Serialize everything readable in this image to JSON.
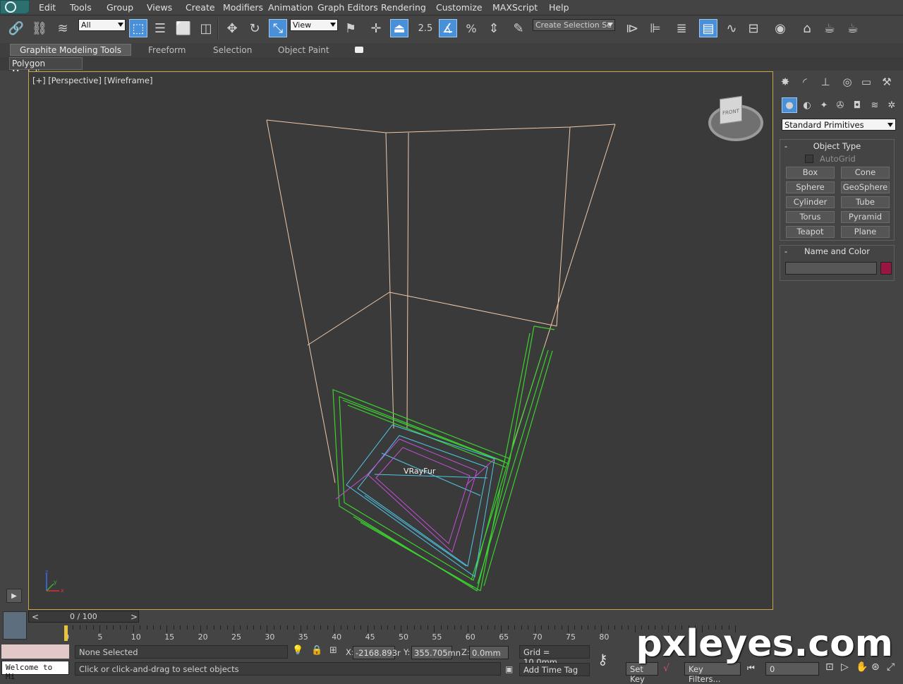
{
  "menu": [
    "Edit",
    "Tools",
    "Group",
    "Views",
    "Create",
    "Modifiers",
    "Animation",
    "Graph Editors",
    "Rendering",
    "Customize",
    "MAXScript",
    "Help"
  ],
  "toolbar": {
    "selection_filter": "All",
    "ref_coord": "View",
    "snap_value": "2.5",
    "named_selection_placeholder": "Create Selection Se",
    "percent_snap_label": "%"
  },
  "ribbon": {
    "tabs": [
      "Graphite Modeling Tools",
      "Freeform",
      "Selection",
      "Object Paint"
    ],
    "panel_label": "Polygon Modeling"
  },
  "viewport": {
    "label": "[+] [Perspective] [Wireframe]",
    "object_label": "VRayFur",
    "viewcube_face": "FRONT",
    "axis_labels": {
      "x": "x",
      "y": "y",
      "z": "z"
    }
  },
  "command_panel": {
    "category": "Standard Primitives",
    "object_type_title": "Object Type",
    "autogrid_label": "AutoGrid",
    "primitives": [
      "Box",
      "Cone",
      "Sphere",
      "GeoSphere",
      "Cylinder",
      "Tube",
      "Torus",
      "Pyramid",
      "Teapot",
      "Plane"
    ],
    "name_color_title": "Name and Color",
    "object_color": "#9b1543",
    "rollout_minus": "-"
  },
  "timeline": {
    "frame_display": "0 / 100",
    "prev": "<",
    "next": ">",
    "tick_labels": [
      "0",
      "5",
      "10",
      "15",
      "20",
      "25",
      "30",
      "35",
      "40",
      "45",
      "50",
      "55",
      "60",
      "65",
      "70",
      "75",
      "80"
    ]
  },
  "status": {
    "welcome": "Welcome to Mi",
    "selection_status": "None Selected",
    "prompt": "Click or click-and-drag to select objects",
    "x_label": "X:",
    "x_value": "-2168.893r",
    "y_label": "Y:",
    "y_value": "355.705mn",
    "z_label": "Z:",
    "z_value": "0.0mm",
    "grid": "Grid = 10.0mm",
    "add_time_tag": "Add Time Tag",
    "set_key": "Set Key",
    "key_filters": "Key Filters...",
    "frame_field": "0"
  },
  "colors": {
    "viewport_border": "#c9a645",
    "active_tool": "#4a90d9",
    "wire_box": "#f0c8a8",
    "wire_green": "#3bd12f",
    "wire_cyan": "#4fc6e8",
    "wire_magenta": "#c450d8"
  },
  "watermark": "pxleyes.com"
}
